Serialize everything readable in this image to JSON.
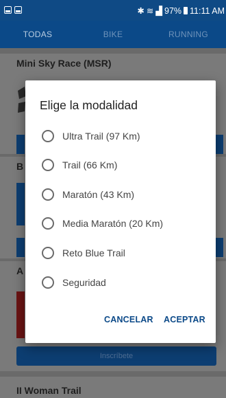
{
  "status_bar": {
    "icons": [
      "screenshot-icon",
      "gallery-icon",
      "bluetooth-icon",
      "wifi-icon",
      "signal-icon",
      "battery-icon"
    ],
    "battery": "97%",
    "time": "11:11 AM"
  },
  "tabs": [
    {
      "label": "TODAS",
      "active": true
    },
    {
      "label": "BIKE",
      "active": false
    },
    {
      "label": "RUNNING",
      "active": false
    }
  ],
  "cards": [
    {
      "title": "Mini Sky Race (MSR)"
    },
    {
      "title": "B"
    },
    {
      "title": "A",
      "button_label": "Inscríbete"
    },
    {
      "title": "II Woman Trail"
    }
  ],
  "dialog": {
    "title": "Elige la modalidad",
    "options": [
      "Ultra Trail (97 Km)",
      "Trail (66 Km)",
      "Maratón (43 Km)",
      "Media Maratón (20 Km)",
      "Reto Blue Trail",
      "Seguridad"
    ],
    "cancel_label": "CANCELAR",
    "accept_label": "ACEPTAR"
  },
  "colors": {
    "primary": "#0b4988",
    "dialog_bg": "#ffffff",
    "scrim": "#4a4a4a"
  }
}
